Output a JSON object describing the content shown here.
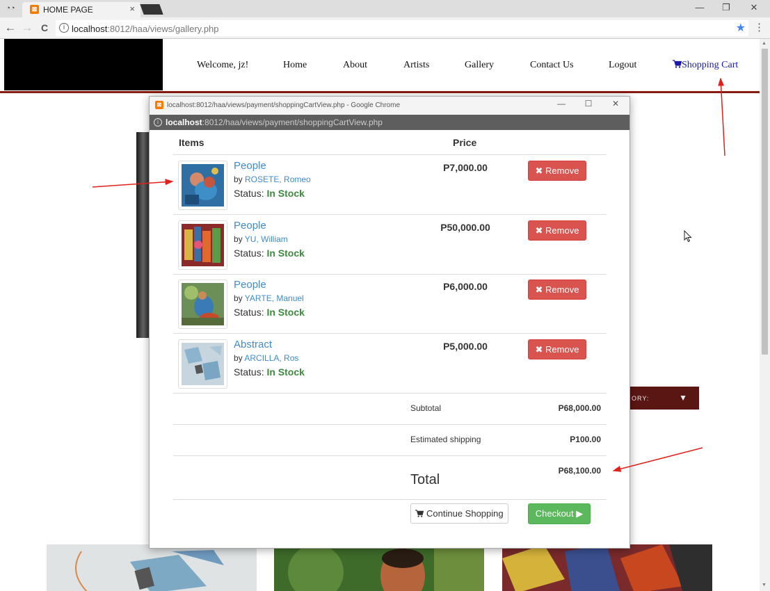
{
  "browser": {
    "tab_title": "HOME PAGE",
    "tab_close": "×",
    "url_host": "localhost",
    "url_path": ":8012/haa/views/gallery.php",
    "back": "←",
    "forward": "→",
    "reload": "C",
    "minimize": "—",
    "restore": "❐",
    "close": "✕",
    "star": "★",
    "menu": "⋮"
  },
  "site": {
    "nav": {
      "welcome": "Welcome, jz!",
      "home": "Home",
      "about": "About",
      "artists": "Artists",
      "gallery": "Gallery",
      "contact": "Contact Us",
      "logout": "Logout",
      "cart": "Shopping Cart"
    },
    "category_label": "ORY:",
    "category_caret": "▼"
  },
  "popup": {
    "title": "localhost:8012/haa/views/payment/shoppingCartView.php - Google Chrome",
    "url_host": "localhost",
    "url_path": ":8012/haa/views/payment/shoppingCartView.php",
    "minimize": "—",
    "maximize": "☐",
    "close": "✕"
  },
  "cart": {
    "headers": {
      "items": "Items",
      "price": "Price"
    },
    "by_prefix": "by ",
    "status_prefix": "Status: ",
    "remove_label": "Remove",
    "items": [
      {
        "title": "People",
        "artist": "ROSETE, Romeo",
        "status": "In Stock",
        "price": "P7,000.00"
      },
      {
        "title": "People",
        "artist": "YU, William",
        "status": "In Stock",
        "price": "P50,000.00"
      },
      {
        "title": "People",
        "artist": "YARTE, Manuel",
        "status": "In Stock",
        "price": "P6,000.00"
      },
      {
        "title": "Abstract",
        "artist": "ARCILLA, Ros",
        "status": "In Stock",
        "price": "P5,000.00"
      }
    ],
    "subtotal_label": "Subtotal",
    "subtotal_value": "P68,000.00",
    "shipping_label": "Estimated shipping",
    "shipping_value": "P100.00",
    "total_label": "Total",
    "total_value": "P68,100.00",
    "continue_label": "Continue Shopping",
    "checkout_label": "Checkout"
  },
  "colors": {
    "accent_link": "#428bca",
    "remove": "#d9534f",
    "checkout": "#5cb85c",
    "stock": "#3c8a3c",
    "site_brand": "#8b1a10",
    "annotation": "#e0201b"
  }
}
